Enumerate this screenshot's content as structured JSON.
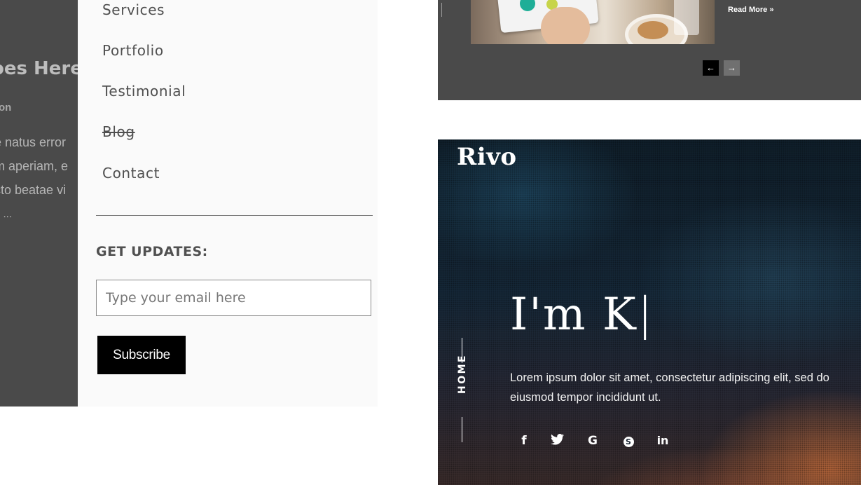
{
  "blog_background": {
    "title_fragment": "oes Here",
    "meta_fragment": "on",
    "excerpt_lines": [
      "e natus error",
      "m aperiam, e",
      "cto beatae vi",
      "d ..."
    ]
  },
  "menu": {
    "items": [
      {
        "label": "Services"
      },
      {
        "label": "Portfolio"
      },
      {
        "label": "Testimonial"
      },
      {
        "label": "Blog"
      },
      {
        "label": "Contact"
      }
    ],
    "updates_label": "GET UPDATES:",
    "email_placeholder": "Type your email here",
    "email_value": "",
    "subscribe_label": "Subscribe"
  },
  "blog_slider": {
    "read_more_label": "Read More",
    "read_more_chevron": "»",
    "prev_icon": "arrow-left",
    "next_icon": "arrow-right",
    "prev_glyph": "←",
    "next_glyph": "→",
    "active_arrow": "prev"
  },
  "hero": {
    "brand": "Rivo",
    "side_label": "HOME",
    "greeting_text": "I'm K",
    "caret": "|",
    "description": "Lorem ipsum dolor sit amet, consectetur adipiscing elit, sed do eiusmod tempor incididunt ut.",
    "social_links": [
      {
        "icon": "facebook-icon",
        "glyph": "f"
      },
      {
        "icon": "twitter-icon",
        "glyph": "🐦"
      },
      {
        "icon": "google-plus-icon",
        "glyph": "G"
      },
      {
        "icon": "skype-icon",
        "glyph": "S"
      },
      {
        "icon": "linkedin-icon",
        "glyph": "in"
      }
    ]
  },
  "colors": {
    "menu_background": "#fafafa",
    "panel_background": "#4a4a4a",
    "subscribe_button": "#000000",
    "hero_text": "#ffffff"
  }
}
